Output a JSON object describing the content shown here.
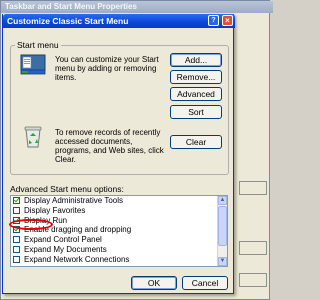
{
  "parent_window": {
    "title": "Taskbar and Start Menu Properties"
  },
  "dialog": {
    "title": "Customize Classic Start Menu",
    "help_glyph": "?",
    "close_glyph": "×",
    "start_menu_group": {
      "label": "Start menu",
      "customize_text": "You can customize your Start menu by adding or removing items.",
      "clear_text": "To remove records of recently accessed documents, programs, and Web sites, click Clear.",
      "buttons": {
        "add": "Add...",
        "remove": "Remove...",
        "advanced": "Advanced",
        "sort": "Sort",
        "clear": "Clear"
      }
    },
    "options": {
      "label": "Advanced Start menu options:",
      "items": [
        {
          "label": "Display Administrative Tools",
          "checked": true
        },
        {
          "label": "Display Favorites",
          "checked": false
        },
        {
          "label": "Display Run",
          "checked": true
        },
        {
          "label": "Enable dragging and dropping",
          "checked": true
        },
        {
          "label": "Expand Control Panel",
          "checked": false
        },
        {
          "label": "Expand My Documents",
          "checked": false
        },
        {
          "label": "Expand Network Connections",
          "checked": false
        }
      ]
    },
    "footer": {
      "ok": "OK",
      "cancel": "Cancel"
    }
  },
  "colors": {
    "titlebar": "#0a46d8",
    "annotation": "#e00000",
    "checkmark": "#21a121"
  }
}
